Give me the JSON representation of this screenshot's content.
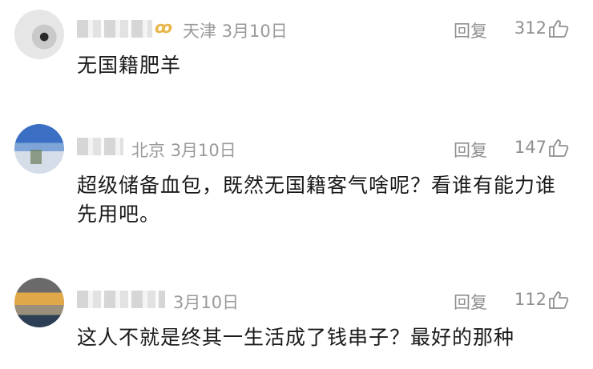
{
  "comments": [
    {
      "location": "天津",
      "date": "3月10日",
      "reply_label": "回复",
      "likes": "312",
      "text": "无国籍肥羊"
    },
    {
      "location": "北京",
      "date": "3月10日",
      "reply_label": "回复",
      "likes": "147",
      "text": "超级储备血包，既然无国籍客气啥呢？看谁有能力谁先用吧。"
    },
    {
      "location": "",
      "date": "3月10日",
      "reply_label": "回复",
      "likes": "112",
      "text": "这人不就是终其一生活成了钱串子？最好的那种"
    }
  ],
  "icons": {
    "vip_badge": "vip-crown-icon",
    "like": "thumbs-up-icon"
  },
  "colors": {
    "meta": "#9a9a9a",
    "text": "#1a1a1a",
    "vip": "#e8b64a"
  }
}
